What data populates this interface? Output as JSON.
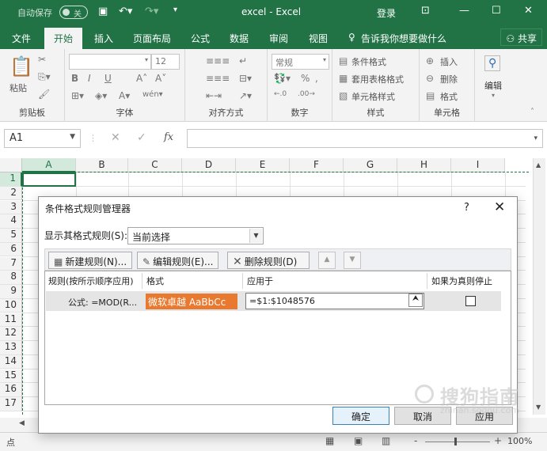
{
  "titlebar": {
    "autosave_label": "自动保存",
    "autosave_state": "关",
    "title": "excel - Excel",
    "login": "登录"
  },
  "ribbon_tabs": [
    "文件",
    "开始",
    "插入",
    "页面布局",
    "公式",
    "数据",
    "审阅",
    "视图"
  ],
  "active_tab": "开始",
  "tell_me": "告诉我你想要做什么",
  "share": "共享",
  "ribbon": {
    "clipboard": {
      "label": "剪贴板",
      "paste": "粘贴"
    },
    "font": {
      "label": "字体",
      "size": "12",
      "bold": "B",
      "italic": "I",
      "underline": "U"
    },
    "alignment": {
      "label": "对齐方式"
    },
    "number": {
      "label": "数字",
      "format": "常规",
      "percent": "%"
    },
    "styles": {
      "label": "样式",
      "conditional": "条件格式",
      "table": "套用表格格式",
      "cell_styles": "单元格样式"
    },
    "cells": {
      "label": "单元格",
      "insert": "插入",
      "delete": "删除",
      "format": "格式"
    },
    "editing": {
      "label": "编辑"
    }
  },
  "formula_bar": {
    "name_box": "A1",
    "fx": "fx",
    "cancel": "✕",
    "enter": "✓",
    "formula": ""
  },
  "columns": [
    "A",
    "B",
    "C",
    "D",
    "E",
    "F",
    "G",
    "H",
    "I"
  ],
  "rows": [
    "1",
    "2",
    "3",
    "4",
    "5",
    "6",
    "7",
    "8",
    "9",
    "10",
    "11",
    "12",
    "13",
    "14",
    "15",
    "16",
    "17"
  ],
  "dialog": {
    "title": "条件格式规则管理器",
    "help": "?",
    "close": "✕",
    "show_rules_label": "显示其格式规则(S):",
    "show_rules_value": "当前选择",
    "new_rule": "新建规则(N)...",
    "edit_rule": "编辑规则(E)...",
    "delete_rule": "删除规则(D)",
    "headers": {
      "rule": "规则(按所示顺序应用)",
      "format": "格式",
      "applies_to": "应用于",
      "stop_if_true": "如果为真则停止"
    },
    "rules": [
      {
        "rule": "公式: =MOD(R...",
        "format_preview": "微软卓越  AaBbCc",
        "applies_to": "=$1:$1048576"
      }
    ],
    "ok": "确定",
    "cancel": "取消",
    "apply": "应用"
  },
  "status": {
    "ready": "点",
    "zoom": "100%",
    "minus": "-",
    "plus": "+"
  },
  "watermark": {
    "text": "搜狗指南",
    "url": "zhinan.sogou.com"
  },
  "colors": {
    "excel_green": "#217346",
    "preview_orange": "#e8792f"
  }
}
